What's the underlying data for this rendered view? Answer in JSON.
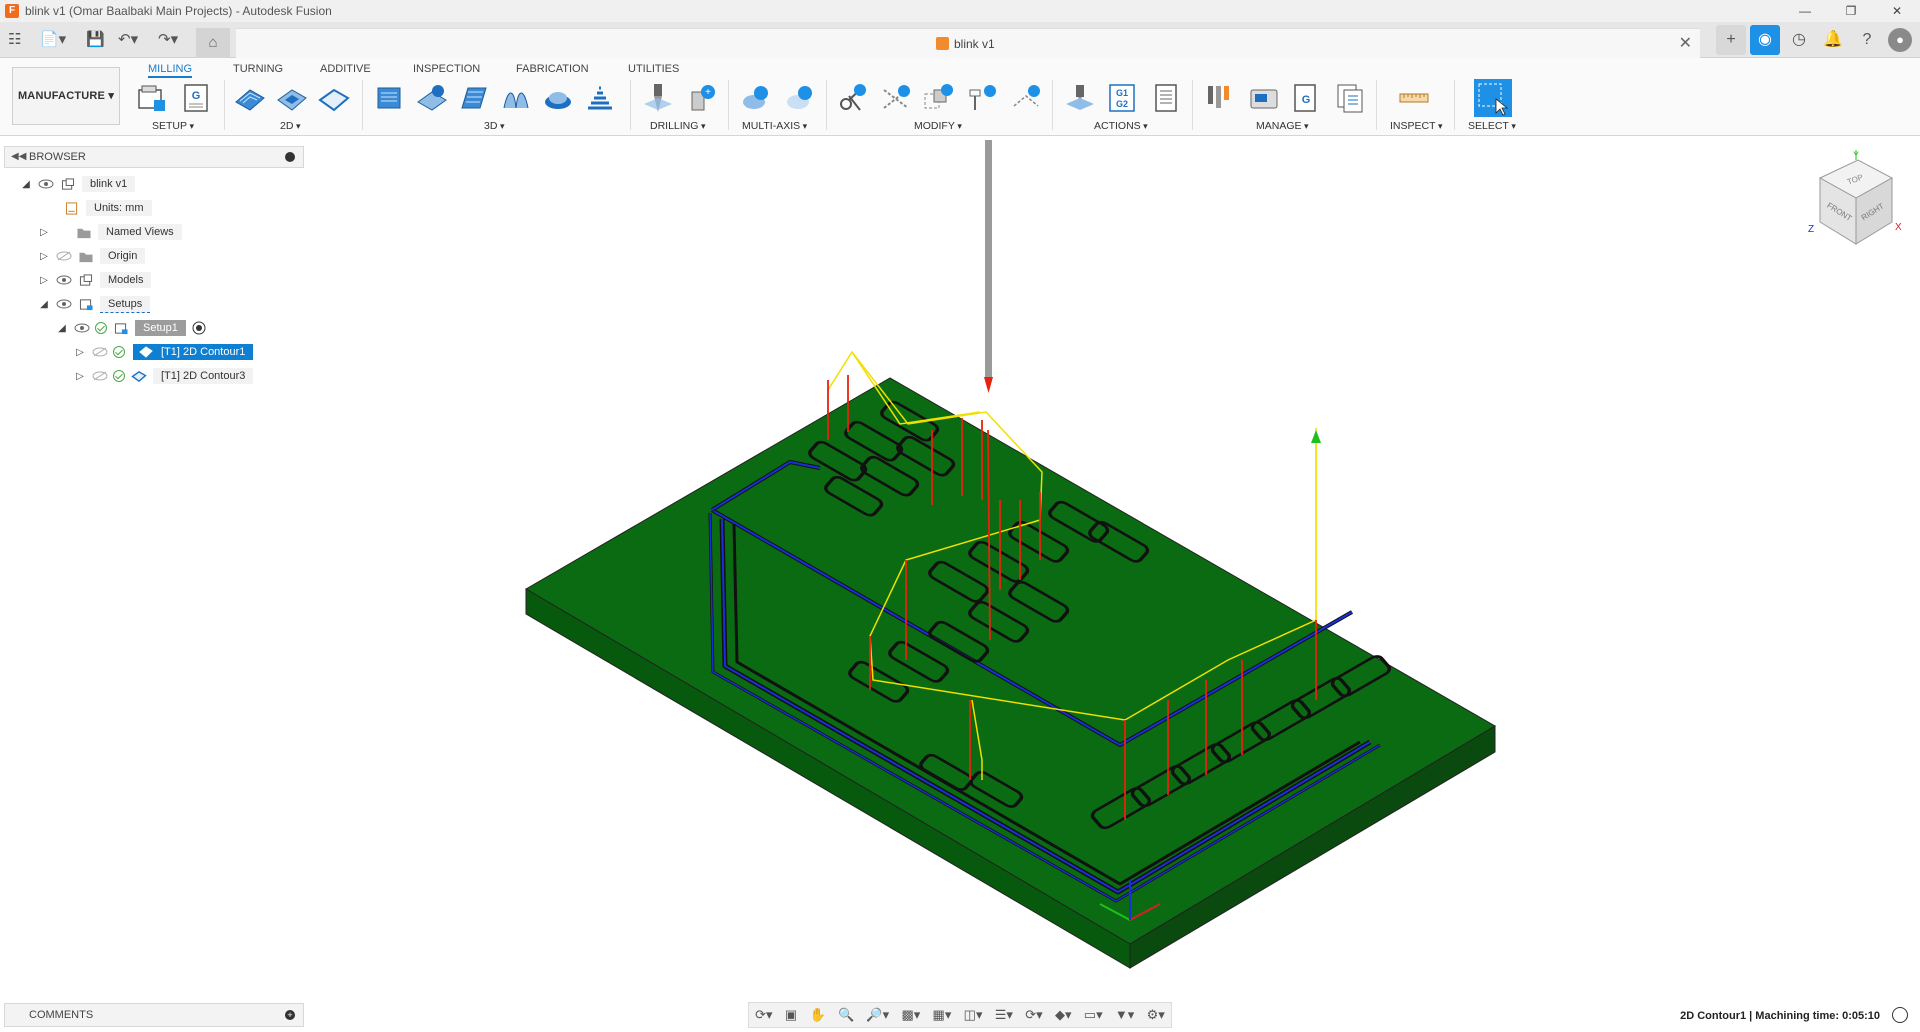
{
  "window": {
    "title": "blink v1 (Omar Baalbaki Main Projects) - Autodesk Fusion",
    "logo_letter": "F"
  },
  "document_tab": {
    "name": "blink v1"
  },
  "workspace": {
    "label": "MANUFACTURE"
  },
  "ribbon": {
    "tabs": [
      "MILLING",
      "TURNING",
      "ADDITIVE",
      "INSPECTION",
      "FABRICATION",
      "UTILITIES"
    ],
    "active_tab": "MILLING",
    "groups": [
      "SETUP",
      "2D",
      "3D",
      "DRILLING",
      "MULTI-AXIS",
      "MODIFY",
      "ACTIONS",
      "MANAGE",
      "INSPECT",
      "SELECT"
    ]
  },
  "browser": {
    "title": "BROWSER",
    "items": [
      {
        "label": "blink v1"
      },
      {
        "label": "Units: mm"
      },
      {
        "label": "Named Views"
      },
      {
        "label": "Origin"
      },
      {
        "label": "Models"
      },
      {
        "label": "Setups"
      },
      {
        "label": "Setup1"
      },
      {
        "label": "[T1] 2D Contour1"
      },
      {
        "label": "[T1] 2D Contour3"
      }
    ]
  },
  "viewcube": {
    "top": "TOP",
    "front": "FRONT",
    "right": "RIGHT",
    "axis_x": "X",
    "axis_y": "Y",
    "axis_z": "Z"
  },
  "comments": {
    "label": "COMMENTS"
  },
  "status": {
    "text": "2D Contour1 | Machining time: 0:05:10"
  },
  "actions_icon": {
    "line1": "G1",
    "line2": "G2"
  },
  "colors": {
    "stock_green": "#0b6b12",
    "stock_side": "#07550d",
    "toolpath_blue": "#1a2fd8",
    "rapid_yellow": "#f0e000",
    "plunge_red": "#e8220c",
    "accent_blue": "#1e90e6"
  }
}
